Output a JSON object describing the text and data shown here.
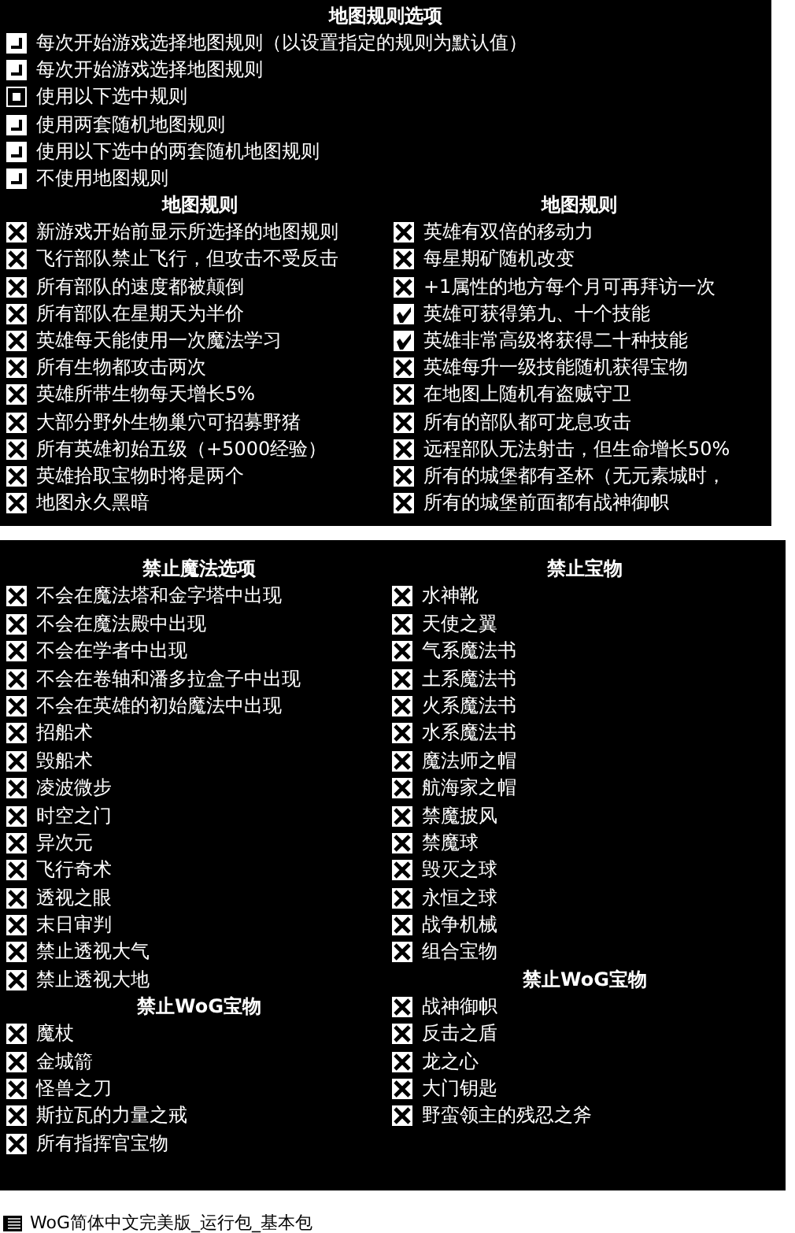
{
  "map_options": {
    "title": "地图规则选项",
    "modes": [
      {
        "label": "每次开始游戏选择地图规则（以设置指定的规则为默认值）",
        "selected": false
      },
      {
        "label": "每次开始游戏选择地图规则",
        "selected": false
      },
      {
        "label": "使用以下选中规则",
        "selected": true
      },
      {
        "label": "使用两套随机地图规则",
        "selected": false
      },
      {
        "label": "使用以下选中的两套随机地图规则",
        "selected": false
      },
      {
        "label": "不使用地图规则",
        "selected": false
      }
    ],
    "columns": [
      {
        "title": "地图规则",
        "rules": [
          {
            "label": "新游戏开始前显示所选择的地图规则",
            "checked": false
          },
          {
            "label": "飞行部队禁止飞行，但攻击不受反击",
            "checked": false
          },
          {
            "label": "所有部队的速度都被颠倒",
            "checked": false
          },
          {
            "label": "所有部队在星期天为半价",
            "checked": false
          },
          {
            "label": "英雄每天能使用一次魔法学习",
            "checked": false
          },
          {
            "label": "所有生物都攻击两次",
            "checked": false
          },
          {
            "label": "英雄所带生物每天增长5%",
            "checked": false
          },
          {
            "label": "大部分野外生物巢穴可招募野猪",
            "checked": false
          },
          {
            "label": "所有英雄初始五级（+5000经验）",
            "checked": false
          },
          {
            "label": "英雄拾取宝物时将是两个",
            "checked": false
          },
          {
            "label": "地图永久黑暗",
            "checked": false
          }
        ]
      },
      {
        "title": "地图规则",
        "rules": [
          {
            "label": "英雄有双倍的移动力",
            "checked": false
          },
          {
            "label": "每星期矿随机改变",
            "checked": false
          },
          {
            "label": "+1属性的地方每个月可再拜访一次",
            "checked": false
          },
          {
            "label": "英雄可获得第九、十个技能",
            "checked": true
          },
          {
            "label": "英雄非常高级将获得二十种技能",
            "checked": true
          },
          {
            "label": "英雄每升一级技能随机获得宝物",
            "checked": false
          },
          {
            "label": "在地图上随机有盗贼守卫",
            "checked": false
          },
          {
            "label": "所有的部队都可龙息攻击",
            "checked": false
          },
          {
            "label": "远程部队无法射击，但生命增长50%",
            "checked": false
          },
          {
            "label": "所有的城堡都有圣杯（无元素城时，",
            "checked": false
          },
          {
            "label": "所有的城堡前面都有战神御帜",
            "checked": false
          }
        ]
      }
    ]
  },
  "bans": {
    "columns": [
      {
        "sections": [
          {
            "title": "禁止魔法选项",
            "items": [
              {
                "label": "不会在魔法塔和金字塔中出现",
                "checked": false
              },
              {
                "label": "不会在魔法殿中出现",
                "checked": false
              },
              {
                "label": "不会在学者中出现",
                "checked": false
              },
              {
                "label": "不会在卷轴和潘多拉盒子中出现",
                "checked": false
              },
              {
                "label": "不会在英雄的初始魔法中出现",
                "checked": false
              },
              {
                "label": "招船术",
                "checked": false
              },
              {
                "label": "毁船术",
                "checked": false
              },
              {
                "label": "凌波微步",
                "checked": false
              },
              {
                "label": "时空之门",
                "checked": false
              },
              {
                "label": "异次元",
                "checked": false
              },
              {
                "label": "飞行奇术",
                "checked": false
              },
              {
                "label": "透视之眼",
                "checked": false
              },
              {
                "label": "末日审判",
                "checked": false
              },
              {
                "label": "禁止透视大气",
                "checked": false
              },
              {
                "label": "禁止透视大地",
                "checked": false
              }
            ]
          },
          {
            "title": "禁止WoG宝物",
            "items": [
              {
                "label": "魔杖",
                "checked": false
              },
              {
                "label": "金城箭",
                "checked": false
              },
              {
                "label": "怪兽之刀",
                "checked": false
              },
              {
                "label": "斯拉瓦的力量之戒",
                "checked": false
              },
              {
                "label": "所有指挥官宝物",
                "checked": false
              }
            ]
          }
        ]
      },
      {
        "sections": [
          {
            "title": "禁止宝物",
            "items": [
              {
                "label": "水神靴",
                "checked": false
              },
              {
                "label": "天使之翼",
                "checked": false
              },
              {
                "label": "气系魔法书",
                "checked": false
              },
              {
                "label": "土系魔法书",
                "checked": false
              },
              {
                "label": "火系魔法书",
                "checked": false
              },
              {
                "label": "水系魔法书",
                "checked": false
              },
              {
                "label": "魔法师之帽",
                "checked": false
              },
              {
                "label": "航海家之帽",
                "checked": false
              },
              {
                "label": "禁魔披风",
                "checked": false
              },
              {
                "label": "禁魔球",
                "checked": false
              },
              {
                "label": "毁灭之球",
                "checked": false
              },
              {
                "label": "永恒之球",
                "checked": false
              },
              {
                "label": "战争机械",
                "checked": false
              },
              {
                "label": "组合宝物",
                "checked": false
              }
            ]
          },
          {
            "title": "禁止WoG宝物",
            "items": [
              {
                "label": "战神御帜",
                "checked": false
              },
              {
                "label": "反击之盾",
                "checked": false
              },
              {
                "label": "龙之心",
                "checked": false
              },
              {
                "label": "大门钥匙",
                "checked": false
              },
              {
                "label": "野蛮领主的残忍之斧",
                "checked": false
              }
            ]
          }
        ]
      }
    ]
  },
  "footer": {
    "label": "WoG简体中文完美版_运行包_基本包"
  }
}
